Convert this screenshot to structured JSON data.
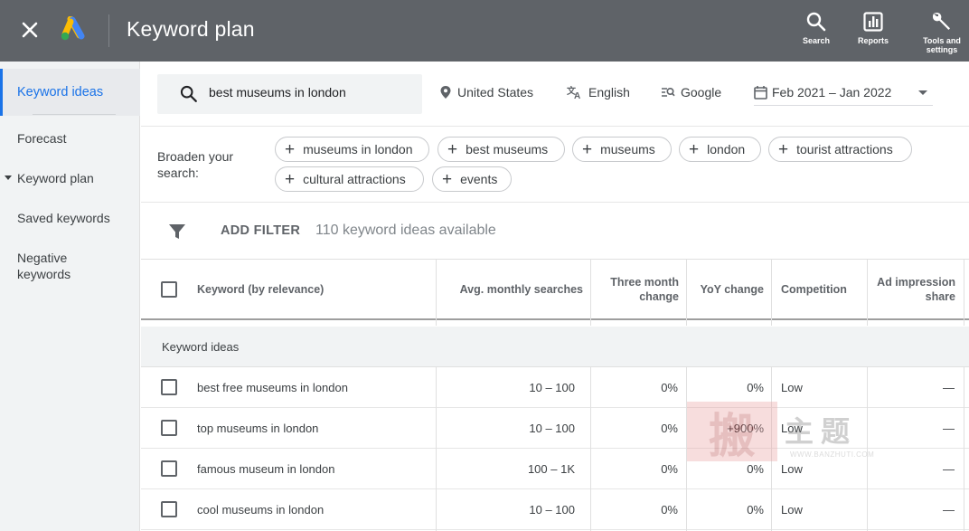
{
  "header": {
    "title": "Keyword plan",
    "actions": [
      {
        "label": "Search",
        "icon": "search-icon"
      },
      {
        "label": "Reports",
        "icon": "reports-icon"
      },
      {
        "label": "Tools and settings",
        "icon": "wrench-icon"
      }
    ]
  },
  "sidebar": {
    "items": [
      {
        "label": "Keyword ideas",
        "active": true
      },
      {
        "label": "Forecast"
      },
      {
        "label": "Keyword plan",
        "expandable": true
      },
      {
        "label": "Saved keywords"
      },
      {
        "label": "Negative keywords"
      }
    ]
  },
  "search": {
    "value": "best museums in london",
    "location": "United States",
    "language": "English",
    "network": "Google",
    "date_range": "Feb 2021 – Jan 2022"
  },
  "broaden": {
    "label": "Broaden your search:",
    "chips": [
      "museums in london",
      "best museums",
      "museums",
      "london",
      "tourist attractions",
      "cultural attractions",
      "events"
    ]
  },
  "filter": {
    "add_label": "ADD FILTER",
    "count_text": "110 keyword ideas available"
  },
  "table": {
    "headers": {
      "keyword": "Keyword (by relevance)",
      "avg": "Avg. monthly searches",
      "three_month": "Three month change",
      "yoy": "YoY change",
      "competition": "Competition",
      "impression": "Ad impression share"
    },
    "group_label": "Keyword ideas",
    "rows": [
      {
        "keyword": "best free museums in london",
        "avg": "10 – 100",
        "three_month": "0%",
        "yoy": "0%",
        "competition": "Low",
        "impression": "—"
      },
      {
        "keyword": "top museums in london",
        "avg": "10 – 100",
        "three_month": "0%",
        "yoy": "+900%",
        "competition": "Low",
        "impression": "—"
      },
      {
        "keyword": "famous museum in london",
        "avg": "100 – 1K",
        "three_month": "0%",
        "yoy": "0%",
        "competition": "Low",
        "impression": "—"
      },
      {
        "keyword": "cool museums in london",
        "avg": "10 – 100",
        "three_month": "0%",
        "yoy": "0%",
        "competition": "Low",
        "impression": "—"
      }
    ]
  },
  "watermark": {
    "big": "搬",
    "small": "主题",
    "url": "WWW.BANZHUTI.COM"
  },
  "colors": {
    "topbar": "#5f6368",
    "accent": "#1a73e8",
    "sidebar": "#f1f3f4"
  }
}
